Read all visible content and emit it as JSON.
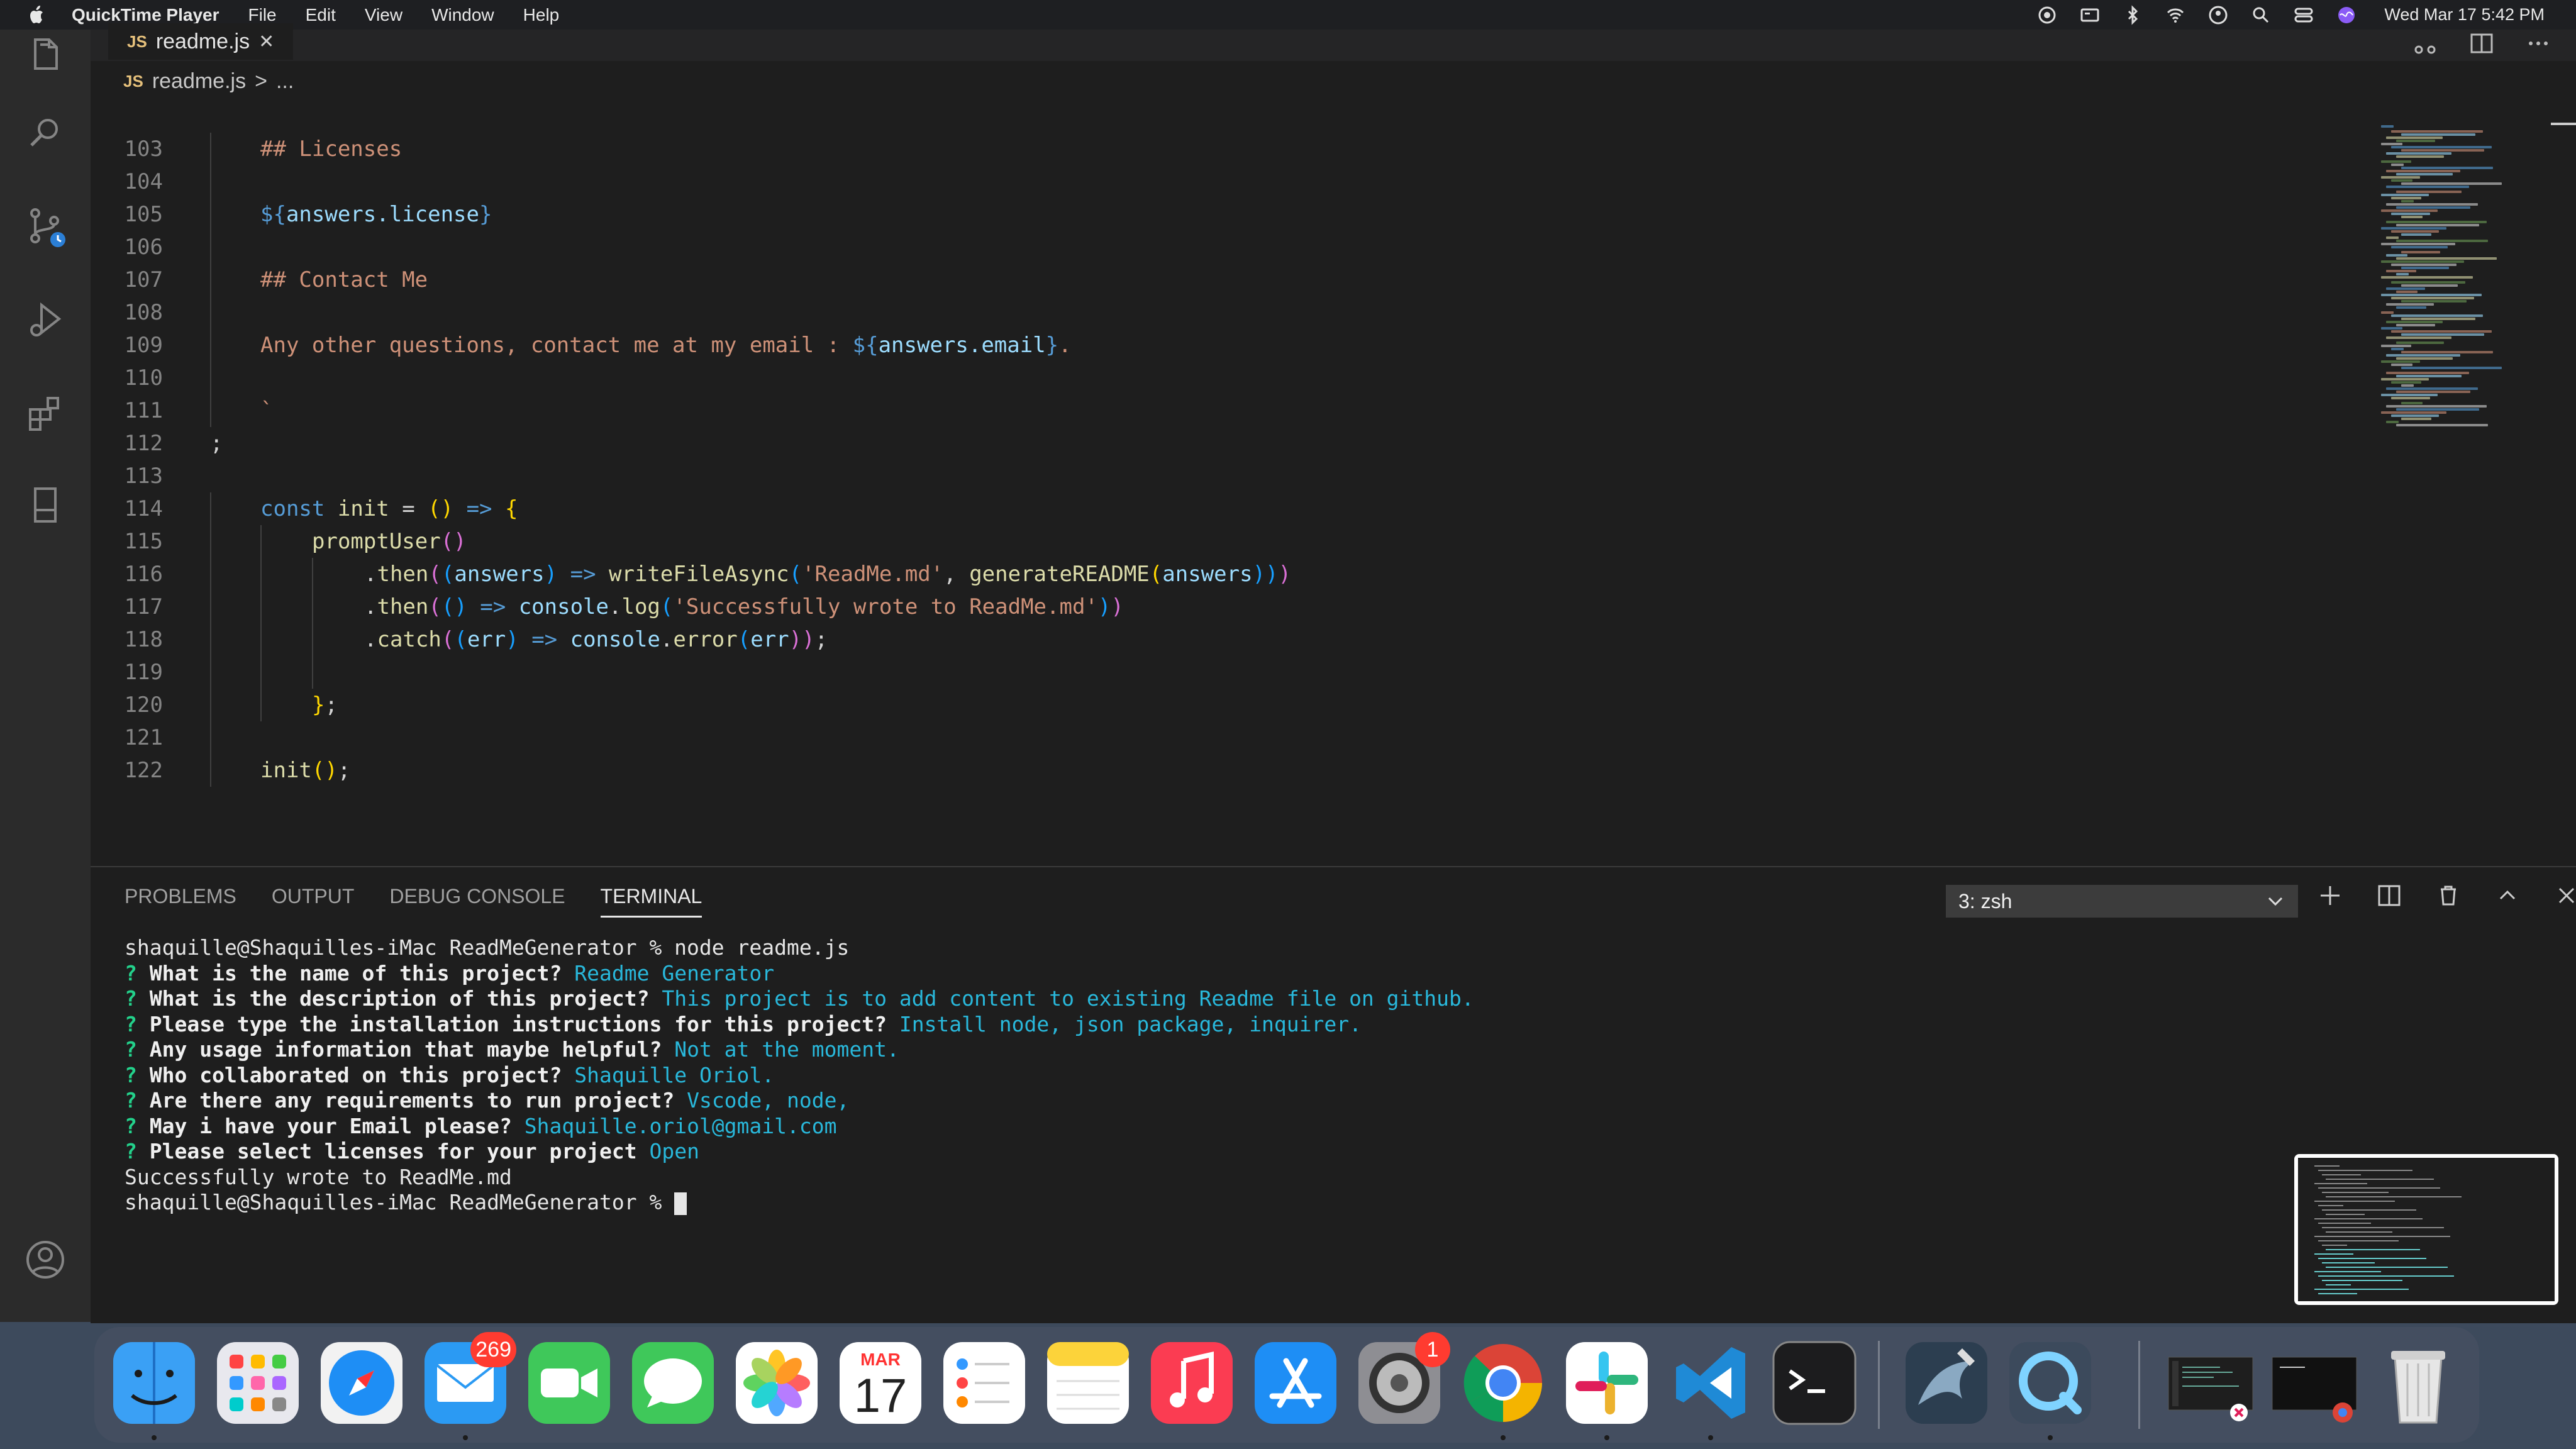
{
  "menubar": {
    "app_name": "QuickTime Player",
    "menus": [
      "File",
      "Edit",
      "View",
      "Window",
      "Help"
    ],
    "clock": "Wed Mar 17  5:42 PM"
  },
  "editor": {
    "tab_label": "readme.js",
    "file_type_badge": "JS",
    "breadcrumb_file": "readme.js",
    "breadcrumb_sep": ">",
    "breadcrumb_more": "...",
    "line_numbers": [
      "103",
      "104",
      "105",
      "106",
      "107",
      "108",
      "109",
      "110",
      "111",
      "112",
      "113",
      "114",
      "115",
      "116",
      "117",
      "118",
      "119",
      "120",
      "121",
      "122"
    ],
    "code": {
      "l103": "## Licenses",
      "l105_open": "${",
      "l105_var": "answers.license",
      "l105_close": "}",
      "l107": "## Contact Me",
      "l109_text": "Any other questions, contact me at my email : ",
      "l109_open": "${",
      "l109_var": "answers.email",
      "l109_close": "}",
      "l109_end": ".",
      "l111": "`",
      "l112": ";",
      "l114_kw": "const",
      "l114_name": "init",
      "l114_eq": " = ",
      "l114_parens": "()",
      "l114_arrow": " => ",
      "l114_brace": "{",
      "l115_fn": "promptUser",
      "l115_parens": "()",
      "l116_dot": ".",
      "l116_then": "then",
      "l116_p1": "(",
      "l116_p2": "(",
      "l116_arg": "answers",
      "l116_p3": ")",
      "l116_arrow": " => ",
      "l116_fn": "writeFileAsync",
      "l116_p4": "(",
      "l116_str": "'ReadMe.md'",
      "l116_comma": ", ",
      "l116_fn2": "generateREADME",
      "l116_p5": "(",
      "l116_arg2": "answers",
      "l116_p6": "))",
      "l116_p7": ")",
      "l117_dot": ".",
      "l117_then": "then",
      "l117_p1": "(",
      "l117_p2": "()",
      "l117_arrow": " => ",
      "l117_obj": "console",
      "l117_dot2": ".",
      "l117_fn": "log",
      "l117_p3": "(",
      "l117_str": "'Successfully wrote to ReadMe.md'",
      "l117_p4": ")",
      "l117_p5": ")",
      "l118_dot": ".",
      "l118_catch": "catch",
      "l118_p1": "(",
      "l118_p2": "(",
      "l118_arg": "err",
      "l118_p3": ")",
      "l118_arrow": " => ",
      "l118_obj": "console",
      "l118_dot2": ".",
      "l118_fn": "error",
      "l118_p4": "(",
      "l118_arg2": "err",
      "l118_p5": "))",
      "l118_semi": ";",
      "l120_brace": "}",
      "l120_semi": ";",
      "l122_fn": "init",
      "l122_parens": "()",
      "l122_semi": ";"
    }
  },
  "panel": {
    "tabs": [
      "PROBLEMS",
      "OUTPUT",
      "DEBUG CONSOLE",
      "TERMINAL"
    ],
    "terminal_select": "3: zsh",
    "terminal": {
      "cmd": "shaquille@Shaquilles-iMac ReadMeGenerator % node readme.js",
      "qmark": "?",
      "q1": "What is the name of this project?",
      "a1": "Readme Generator",
      "q2": "What is the description of this project?",
      "a2": "This project is to add content to existing Readme file on github.",
      "q3": "Please type the installation instructions for this project?",
      "a3": "Install node, json package, inquirer.",
      "q4": "Any usage information that maybe helpful?",
      "a4": "Not at the moment.",
      "q5": "Who collaborated on this project?",
      "a5": "Shaquille Oriol.",
      "q6": "Are there any requirements to run project?",
      "a6": "Vscode, node,",
      "q7": "May i have your Email please?",
      "a7": "Shaquille.oriol@gmail.com",
      "q8": "Please select licenses for your project",
      "a8": "Open",
      "success": "Successfully wrote to ReadMe.md",
      "prompt": "shaquille@Shaquilles-iMac ReadMeGenerator % "
    }
  },
  "dock": {
    "mail_badge": "269",
    "calendar_month": "MAR",
    "calendar_day": "17",
    "settings_badge": "1"
  },
  "colors": {
    "editor_bg": "#1e1e1e",
    "keyword": "#569cd6",
    "function": "#dcdcaa",
    "variable": "#9cdcfe",
    "string": "#ce9178",
    "terminal_question": "#23d18b",
    "terminal_answer": "#29b8db"
  }
}
